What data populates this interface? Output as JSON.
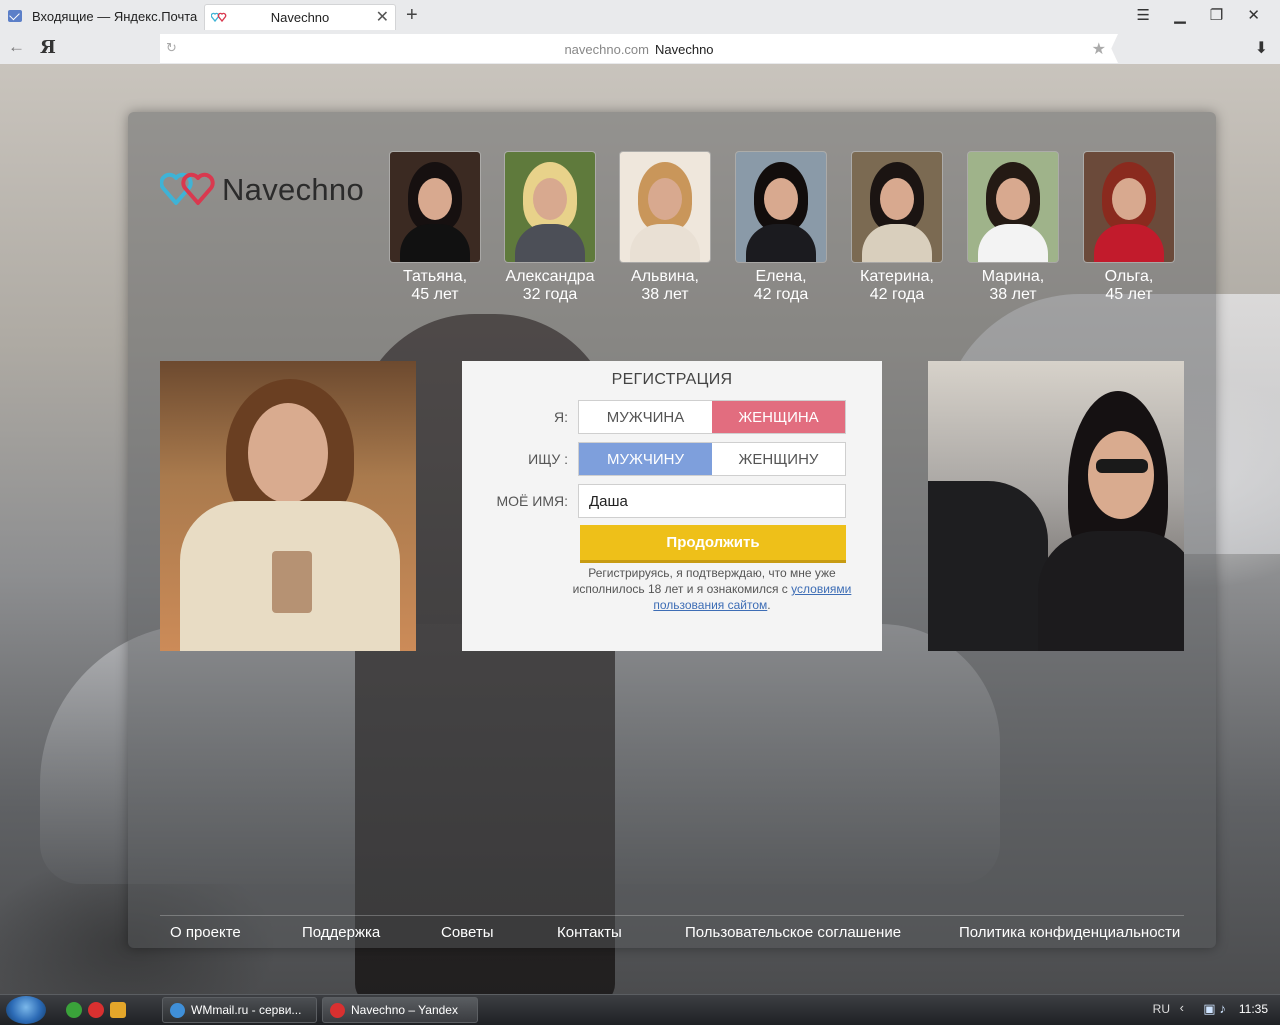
{
  "browser": {
    "tabs": [
      {
        "title": "Входящие — Яндекс.Почта",
        "active": false
      },
      {
        "title": "Navechno",
        "active": true
      }
    ],
    "address": {
      "domain": "navechno.com",
      "page_title": "Navechno"
    },
    "logo_letter": "Я"
  },
  "site": {
    "logo_text": "Navechno",
    "accent_pink": "#e26d7f",
    "accent_blue": "#7e9fdc",
    "button_color": "#eec019"
  },
  "profiles": [
    {
      "name": "Татьяна,",
      "age": "45 лет"
    },
    {
      "name": "Александра",
      "age": "32 года"
    },
    {
      "name": "Альвина,",
      "age": "38 лет"
    },
    {
      "name": "Елена,",
      "age": "42 года"
    },
    {
      "name": "Катерина,",
      "age": "42 года"
    },
    {
      "name": "Марина,",
      "age": "38 лет"
    },
    {
      "name": "Ольга,",
      "age": "45 лет"
    }
  ],
  "registration": {
    "title": "РЕГИСТРАЦИЯ",
    "i_am_label": "Я:",
    "i_am_options": [
      "МУЖЧИНА",
      "ЖЕНЩИНА"
    ],
    "i_am_selected": "ЖЕНЩИНА",
    "seeking_label": "ИЩУ :",
    "seeking_options": [
      "МУЖЧИНУ",
      "ЖЕНЩИНУ"
    ],
    "seeking_selected": "МУЖЧИНУ",
    "name_label": "МОЁ ИМЯ:",
    "name_value": "Даша",
    "continue_label": "Продолжить",
    "note_text": "Регистрируясь, я подтверждаю, что мне уже исполнилось 18 лет и я ознакомился с",
    "terms_link": "условиями пользования сайтом",
    "note_end": "."
  },
  "footer": {
    "links": [
      "О проекте",
      "Поддержка",
      "Советы",
      "Контакты",
      "Пользовательское соглашение",
      "Политика конфиденциальности"
    ]
  },
  "taskbar": {
    "windows": [
      {
        "title": "WMmail.ru - серви..."
      },
      {
        "title": "Navechno – Yandex"
      }
    ],
    "language": "RU",
    "clock": "11:35"
  }
}
